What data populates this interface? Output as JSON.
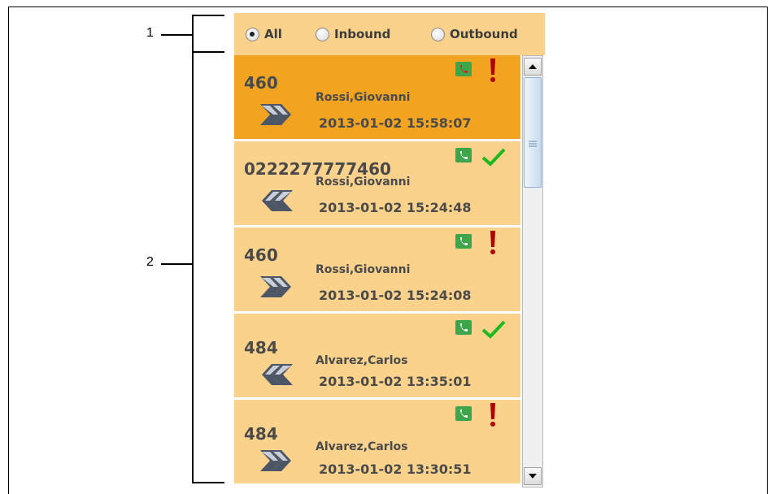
{
  "callouts": [
    "1",
    "2"
  ],
  "filter": {
    "options": [
      {
        "label": "All",
        "checked": true
      },
      {
        "label": "Inbound",
        "checked": false
      },
      {
        "label": "Outbound",
        "checked": false
      }
    ]
  },
  "calls": [
    {
      "number": "460",
      "name": "Rossi,Giovanni",
      "timestamp": "2013-01-02 15:58:07",
      "direction": "outbound",
      "phone_icon": "phone-red-handset-icon",
      "status_icon": "exclamation-icon",
      "selected": true
    },
    {
      "number": "0222277777460",
      "name": "Rossi,Giovanni",
      "timestamp": "2013-01-02 15:24:48",
      "direction": "inbound",
      "phone_icon": "phone-icon",
      "status_icon": "checkmark-icon",
      "selected": false
    },
    {
      "number": "460",
      "name": "Rossi,Giovanni",
      "timestamp": "2013-01-02 15:24:08",
      "direction": "outbound",
      "phone_icon": "phone-icon",
      "status_icon": "exclamation-icon",
      "selected": false
    },
    {
      "number": "484",
      "name": "Alvarez,Carlos",
      "timestamp": "2013-01-02 13:35:01",
      "direction": "inbound",
      "phone_icon": "phone-icon",
      "status_icon": "checkmark-icon",
      "selected": false
    },
    {
      "number": "484",
      "name": "Alvarez,Carlos",
      "timestamp": "2013-01-02 13:30:51",
      "direction": "outbound",
      "phone_icon": "phone-icon",
      "status_icon": "exclamation-icon",
      "selected": false
    }
  ],
  "colors": {
    "row_bg": "#fbd28c",
    "row_selected_bg": "#f2a421",
    "arrow": "#4d5666",
    "phone_green": "#3ea54a",
    "check_green": "#1db81d",
    "exclamation_red": "#b00000"
  }
}
